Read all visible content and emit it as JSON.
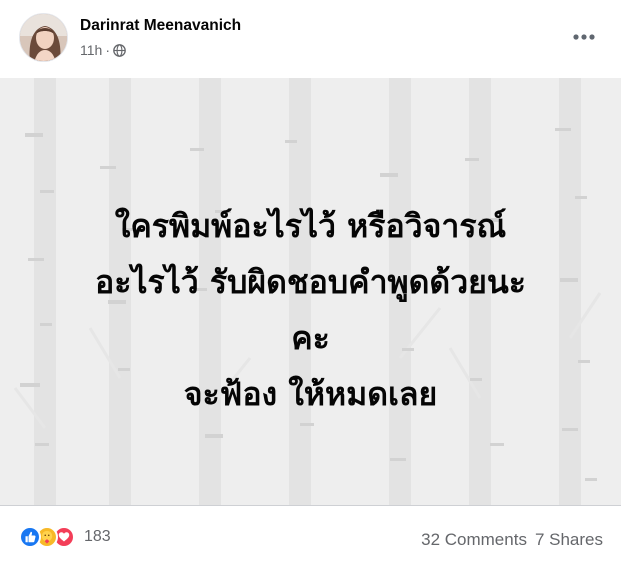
{
  "post": {
    "author": "Darinrat Meenavanich",
    "time": "11h",
    "separator": "·",
    "privacy_icon": "globe-icon",
    "more_icon": "more-options-icon",
    "status_lines": [
      "ใครพิมพ์อะไรไว้ หรือวิจารณ์",
      "อะไรไว้ รับผิดชอบคำพูดด้วยนะ",
      "คะ",
      "จะฟ้อง ให้หมดเลย"
    ],
    "background_color": "#eeeeee"
  },
  "footer": {
    "reaction_icons": [
      "like-icon",
      "care-icon",
      "love-icon"
    ],
    "reaction_count": "183",
    "comments": "32 Comments",
    "shares": "7 Shares"
  },
  "colors": {
    "like": "#1877f2",
    "care": "#f7b928",
    "love": "#f33e58",
    "secondary_text": "#65676b"
  }
}
